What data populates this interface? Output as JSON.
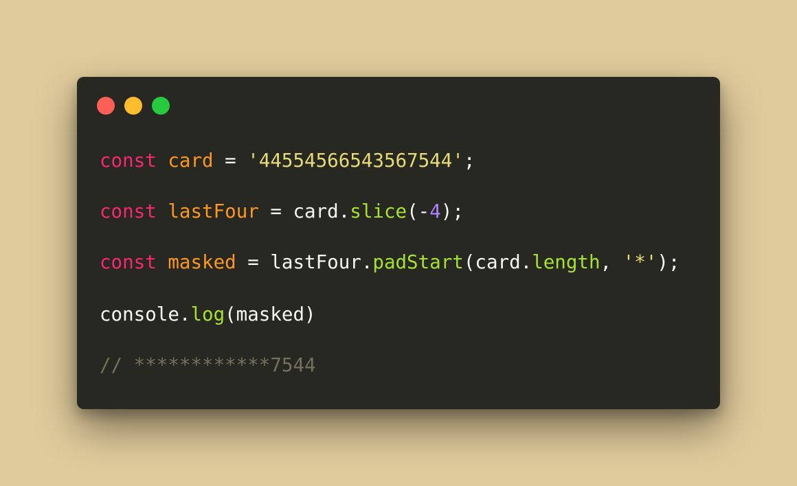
{
  "colors": {
    "background": "#e0cb9c",
    "editor": "#272822",
    "close": "#ff5f56",
    "minimize": "#ffbd2e",
    "maximize": "#27c93f",
    "keyword": "#f92672",
    "variable": "#fd971f",
    "string": "#e6db74",
    "function": "#a6e22e",
    "number": "#ae81ff",
    "comment": "#75715e"
  },
  "code": {
    "line1": {
      "kw": "const",
      "name": "card",
      "eq": " = ",
      "value": "'44554566543567544'",
      "end": ";"
    },
    "line2": {
      "kw": "const",
      "name": "lastFour",
      "eq": " = ",
      "obj": "card.",
      "method": "slice",
      "open": "(-",
      "num": "4",
      "close": ");"
    },
    "line3": {
      "kw": "const",
      "name": "masked",
      "eq": " = ",
      "obj": "lastFour.",
      "method": "padStart",
      "open": "(card.",
      "prop": "length",
      "comma": ", ",
      "str": "'*'",
      "close": ");"
    },
    "line4": {
      "obj": "console.",
      "method": "log",
      "args": "(masked)"
    },
    "line5": {
      "comment": "// ************7544"
    }
  }
}
